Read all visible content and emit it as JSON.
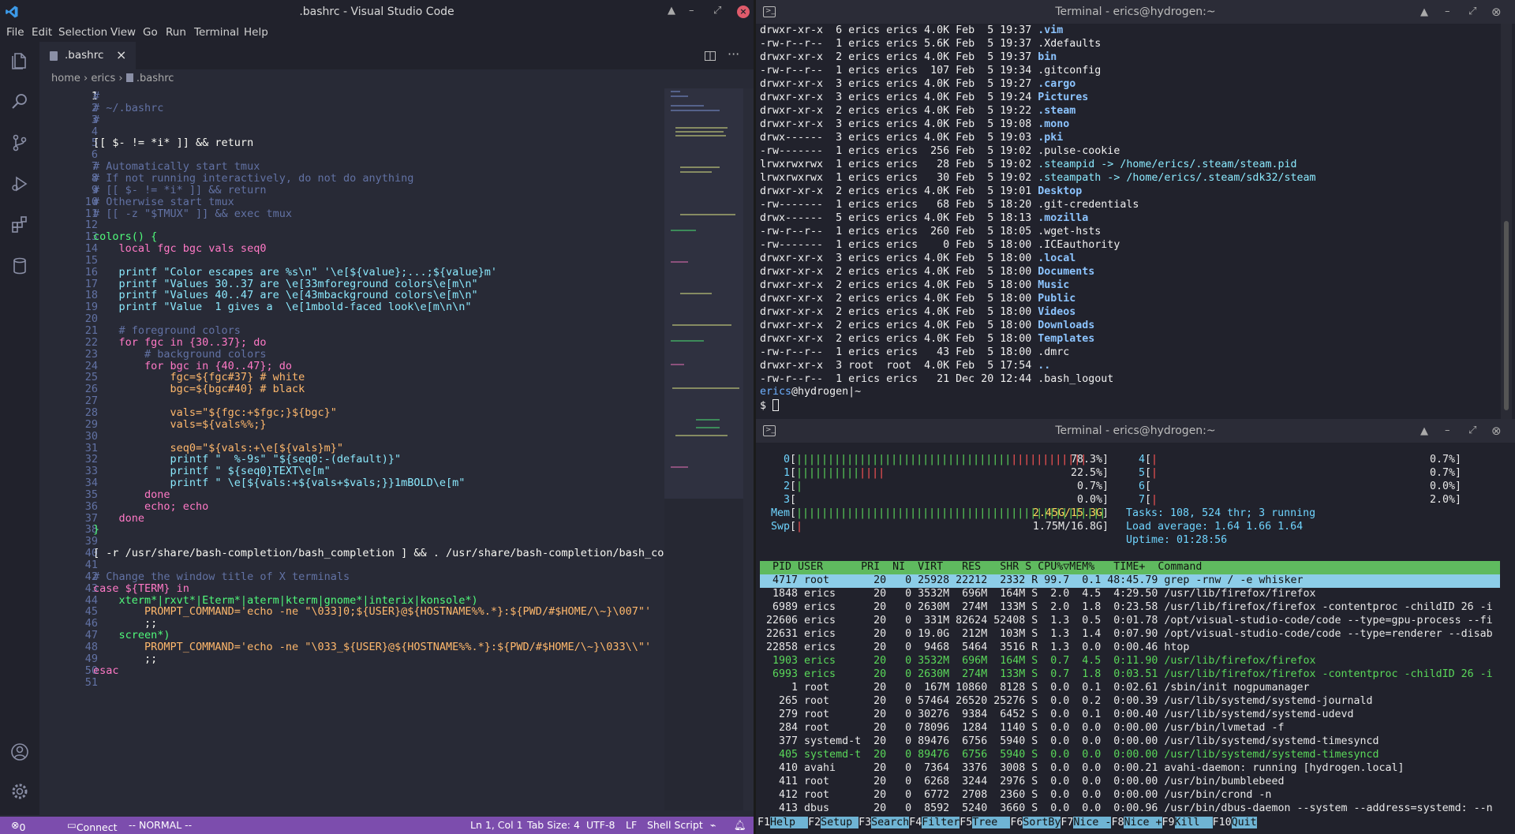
{
  "vscode": {
    "window_title": ".bashrc - Visual Studio Code",
    "menu": [
      "File",
      "Edit",
      "Selection",
      "View",
      "Go",
      "Run",
      "Terminal",
      "Help"
    ],
    "tab_label": ".bashrc",
    "breadcrumb": {
      "a": "home",
      "b": "erics",
      "c": ".bashrc"
    },
    "code_lines": [
      "#",
      "# ~/.bashrc",
      "#",
      "",
      "[[ $- != *i* ]] && return",
      "",
      "# Automatically start tmux",
      "# If not running interactively, do not do anything",
      "# [[ $- != *i* ]] && return",
      "# Otherwise start tmux",
      "# [[ -z \"$TMUX\" ]] && exec tmux",
      "",
      "colors() {",
      "    local fgc bgc vals seq0",
      "",
      "    printf \"Color escapes are %s\\n\" '\\e[${value};...;${value}m'",
      "    printf \"Values 30..37 are \\e[33mforeground colors\\e[m\\n\"",
      "    printf \"Values 40..47 are \\e[43mbackground colors\\e[m\\n\"",
      "    printf \"Value  1 gives a  \\e[1mbold-faced look\\e[m\\n\\n\"",
      "",
      "    # foreground colors",
      "    for fgc in {30..37}; do",
      "        # background colors",
      "        for bgc in {40..47}; do",
      "            fgc=${fgc#37} # white",
      "            bgc=${bgc#40} # black",
      "",
      "            vals=\"${fgc:+$fgc;}${bgc}\"",
      "            vals=${vals%%;}",
      "",
      "            seq0=\"${vals:+\\e[${vals}m}\"",
      "            printf \"  %-9s\" \"${seq0:-(default)}\"",
      "            printf \" ${seq0}TEXT\\e[m\"",
      "            printf \" \\e[${vals:+${vals+$vals;}}1mBOLD\\e[m\"",
      "        done",
      "        echo; echo",
      "    done",
      "}",
      "",
      "[ -r /usr/share/bash-completion/bash_completion ] && . /usr/share/bash-completion/bash_comple",
      "",
      "# Change the window title of X terminals",
      "case ${TERM} in",
      "    xterm*|rxvt*|Eterm*|aterm|kterm|gnome*|interix|konsole*)",
      "        PROMPT_COMMAND='echo -ne \"\\033]0;${USER}@${HOSTNAME%%.*}:${PWD/#$HOME/\\~}\\007\"'",
      "        ;;",
      "    screen*)",
      "        PROMPT_COMMAND='echo -ne \"\\033_${USER}@${HOSTNAME%%.*}:${PWD/#$HOME/\\~}\\033\\\\\"'",
      "        ;;",
      "esac",
      ""
    ],
    "status": {
      "problems": "0 ⚠ 0",
      "connect": "Connect",
      "mode": "-- NORMAL --",
      "position": "Ln 1, Col 1",
      "tabsize": "Tab Size: 4",
      "encoding": "UTF-8",
      "eol": "LF",
      "lang": "Shell Script"
    }
  },
  "term1": {
    "title": "Terminal - erics@hydrogen:~",
    "rows": [
      [
        "drwxr-xr-x  6 erics erics 4.0K Feb  5 19:37 ",
        ".vim",
        "d"
      ],
      [
        "-rw-r--r--  1 erics erics 5.6K Feb  5 19:37 ",
        ".Xdefaults",
        "f"
      ],
      [
        "drwxr-xr-x  2 erics erics 4.0K Feb  5 19:37 ",
        "bin",
        "d"
      ],
      [
        "-rw-r--r--  1 erics erics  107 Feb  5 19:34 ",
        ".gitconfig",
        "f"
      ],
      [
        "drwxr-xr-x  3 erics erics 4.0K Feb  5 19:27 ",
        ".cargo",
        "d"
      ],
      [
        "drwxr-xr-x  3 erics erics 4.0K Feb  5 19:24 ",
        "Pictures",
        "d"
      ],
      [
        "drwxr-xr-x  2 erics erics 4.0K Feb  5 19:22 ",
        ".steam",
        "d"
      ],
      [
        "drwxr-xr-x  3 erics erics 4.0K Feb  5 19:08 ",
        ".mono",
        "d"
      ],
      [
        "drwx------  3 erics erics 4.0K Feb  5 19:03 ",
        ".pki",
        "d"
      ],
      [
        "-rw-------  1 erics erics  256 Feb  5 19:02 ",
        ".pulse-cookie",
        "f"
      ],
      [
        "lrwxrwxrwx  1 erics erics   28 Feb  5 19:02 ",
        ".steampid -> /home/erics/.steam/steam.pid",
        "l"
      ],
      [
        "lrwxrwxrwx  1 erics erics   30 Feb  5 19:02 ",
        ".steampath -> /home/erics/.steam/sdk32/steam",
        "l"
      ],
      [
        "drwxr-xr-x  2 erics erics 4.0K Feb  5 19:01 ",
        "Desktop",
        "d"
      ],
      [
        "-rw-------  1 erics erics   68 Feb  5 18:20 ",
        ".git-credentials",
        "f"
      ],
      [
        "drwx------  5 erics erics 4.0K Feb  5 18:13 ",
        ".mozilla",
        "d"
      ],
      [
        "-rw-r--r--  1 erics erics  260 Feb  5 18:05 ",
        ".wget-hsts",
        "f"
      ],
      [
        "-rw-------  1 erics erics    0 Feb  5 18:00 ",
        ".ICEauthority",
        "f"
      ],
      [
        "drwxr-xr-x  3 erics erics 4.0K Feb  5 18:00 ",
        ".local",
        "d"
      ],
      [
        "drwxr-xr-x  2 erics erics 4.0K Feb  5 18:00 ",
        "Documents",
        "d"
      ],
      [
        "drwxr-xr-x  2 erics erics 4.0K Feb  5 18:00 ",
        "Music",
        "d"
      ],
      [
        "drwxr-xr-x  2 erics erics 4.0K Feb  5 18:00 ",
        "Public",
        "d"
      ],
      [
        "drwxr-xr-x  2 erics erics 4.0K Feb  5 18:00 ",
        "Videos",
        "d"
      ],
      [
        "drwxr-xr-x  2 erics erics 4.0K Feb  5 18:00 ",
        "Downloads",
        "d"
      ],
      [
        "drwxr-xr-x  2 erics erics 4.0K Feb  5 18:00 ",
        "Templates",
        "d"
      ],
      [
        "-rw-r--r--  1 erics erics   43 Feb  5 18:00 ",
        ".dmrc",
        "f"
      ],
      [
        "drwxr-xr-x  3 root  root  4.0K Feb  5 17:54 ",
        "..",
        "d"
      ],
      [
        "-rw-r--r--  1 erics erics   21 Dec 20 12:44 ",
        ".bash_logout",
        "f"
      ]
    ],
    "prompt_user": "erics",
    "prompt_host": "@hydrogen",
    "prompt_path": "|~",
    "prompt_symbol": "$ "
  },
  "term2": {
    "title": "Terminal - erics@hydrogen:~",
    "cpu": [
      {
        "id": "0",
        "bar": "||||||||||||||||||||||||||||||||||",
        "red": "||||||||||||",
        "pct": "78.3%"
      },
      {
        "id": "1",
        "bar": "||||||||||",
        "red": "||||",
        "pct": "22.5%"
      },
      {
        "id": "2",
        "bar": "|",
        "red": "",
        "pct": "0.7%"
      },
      {
        "id": "3",
        "bar": "",
        "red": "",
        "pct": "0.0%"
      }
    ],
    "cpu_right": [
      {
        "id": "4",
        "bar": "|",
        "pct": "0.7%"
      },
      {
        "id": "5",
        "bar": "|",
        "pct": "0.7%"
      },
      {
        "id": "6",
        "bar": "",
        "pct": "0.0%"
      },
      {
        "id": "7",
        "bar": "|",
        "pct": "2.0%"
      }
    ],
    "mem_label": "Mem",
    "mem_bar": "|||||||||||||||||||||||||||||||||||||||||||||||||",
    "mem_val": "2.45G/15.3G",
    "swp_label": "Swp",
    "swp_bar": "|",
    "swp_val": "1.75M/16.8G",
    "tasks": "Tasks: 108, 524 thr; 3 running",
    "load": "Load average: 1.64 1.66 1.64",
    "uptime": "Uptime: 01:28:56",
    "header": "  PID USER      PRI  NI  VIRT   RES   SHR S CPU%▽MEM%   TIME+  Command",
    "procs": [
      "  4717 root       20   0 25928 22212  2332 R 99.7  0.1 48:45.79 grep -rnw / -e whisker",
      "  1848 erics      20   0 3532M  696M  164M S  2.0  4.5  4:29.50 /usr/lib/firefox/firefox",
      "  6989 erics      20   0 2630M  274M  133M S  2.0  1.8  0:23.58 /usr/lib/firefox/firefox -contentproc -childID 26 -i",
      " 22606 erics      20   0  331M 82624 52408 S  1.3  0.5  0:01.78 /opt/visual-studio-code/code --type=gpu-process --fi",
      " 22631 erics      20   0 19.0G  212M  103M S  1.3  1.4  0:07.90 /opt/visual-studio-code/code --type=renderer --disab",
      " 22858 erics      20   0  9468  5464  3516 R  1.3  0.0  0:00.46 htop",
      "  1903 erics      20   0 3532M  696M  164M S  0.7  4.5  0:11.90 /usr/lib/firefox/firefox",
      "  6993 erics      20   0 2630M  274M  133M S  0.7  1.8  0:03.51 /usr/lib/firefox/firefox -contentproc -childID 26 -i",
      "     1 root       20   0  167M 10860  8128 S  0.0  0.1  0:02.61 /sbin/init nogpumanager",
      "   265 root       20   0 57464 26520 25276 S  0.0  0.2  0:00.39 /usr/lib/systemd/systemd-journald",
      "   279 root       20   0 30276  9384  6452 S  0.0  0.1  0:00.40 /usr/lib/systemd/systemd-udevd",
      "   284 root       20   0 78096  1284  1140 S  0.0  0.0  0:00.00 /usr/bin/lvmetad -f",
      "   377 systemd-t  20   0 89476  6756  5940 S  0.0  0.0  0:00.00 /usr/lib/systemd/systemd-timesyncd",
      "   405 systemd-t  20   0 89476  6756  5940 S  0.0  0.0  0:00.00 /usr/lib/systemd/systemd-timesyncd",
      "   410 avahi      20   0  7364  3376  3008 S  0.0  0.0  0:00.21 avahi-daemon: running [hydrogen.local]",
      "   411 root       20   0  6268  3244  2976 S  0.0  0.0  0:00.00 /usr/bin/bumblebeed",
      "   412 root       20   0  6772  2708  2360 S  0.0  0.0  0:00.00 /usr/bin/crond -n",
      "   413 dbus       20   0  8592  5240  3660 S  0.0  0.0  0:00.96 /usr/bin/dbus-daemon --system --address=systemd: --n"
    ],
    "fkeys": [
      [
        "F1",
        "Help  "
      ],
      [
        "F2",
        "Setup "
      ],
      [
        "F3",
        "Search"
      ],
      [
        "F4",
        "Filter"
      ],
      [
        "F5",
        "Tree  "
      ],
      [
        "F6",
        "SortBy"
      ],
      [
        "F7",
        "Nice -"
      ],
      [
        "F8",
        "Nice +"
      ],
      [
        "F9",
        "Kill  "
      ],
      [
        "F10",
        "Quit"
      ]
    ]
  }
}
